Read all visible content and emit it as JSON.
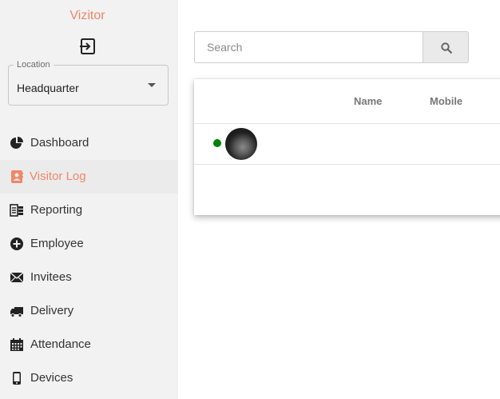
{
  "sidebar": {
    "brand": "Vizitor",
    "location": {
      "label": "Location",
      "value": "Headquarter"
    },
    "items": [
      {
        "label": "Dashboard",
        "icon": "pie-chart-icon",
        "active": false
      },
      {
        "label": "Visitor Log",
        "icon": "contact-book-icon",
        "active": true
      },
      {
        "label": "Reporting",
        "icon": "report-icon",
        "active": false
      },
      {
        "label": "Employee",
        "icon": "plus-circle-icon",
        "active": false
      },
      {
        "label": "Invitees",
        "icon": "envelope-icon",
        "active": false
      },
      {
        "label": "Delivery",
        "icon": "truck-icon",
        "active": false
      },
      {
        "label": "Attendance",
        "icon": "calendar-icon",
        "active": false
      },
      {
        "label": "Devices",
        "icon": "mobile-icon",
        "active": false
      }
    ]
  },
  "search": {
    "placeholder": "Search",
    "value": ""
  },
  "table": {
    "columns": [
      "Name",
      "Mobile"
    ],
    "rows": [
      {
        "status": "online",
        "name": "",
        "mobile": ""
      }
    ]
  },
  "colors": {
    "accent": "#f0866a",
    "status_online": "#008000"
  }
}
